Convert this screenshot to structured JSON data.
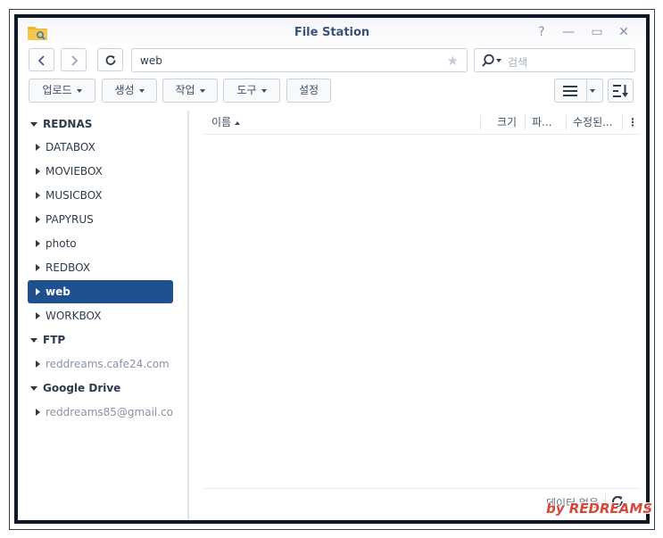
{
  "window": {
    "title": "File Station",
    "help_label": "?",
    "minimize_label": "—",
    "maximize_label": "▭",
    "close_label": "✕"
  },
  "navigation": {
    "back_icon": "chevron-left-icon",
    "forward_icon": "chevron-right-icon",
    "refresh_icon": "refresh-icon",
    "path_value": "web",
    "favorite_icon": "star-icon",
    "search_placeholder": "검색"
  },
  "toolbar": {
    "upload_label": "업로드",
    "create_label": "생성",
    "action_label": "작업",
    "tools_label": "도구",
    "settings_label": "설정"
  },
  "sidebar": {
    "groups": [
      {
        "label": "REDNAS",
        "items": [
          {
            "label": "DATABOX"
          },
          {
            "label": "MOVIEBOX"
          },
          {
            "label": "MUSICBOX"
          },
          {
            "label": "PAPYRUS"
          },
          {
            "label": "photo"
          },
          {
            "label": "REDBOX"
          },
          {
            "label": "web",
            "selected": true
          },
          {
            "label": "WORKBOX"
          }
        ]
      },
      {
        "label": "FTP",
        "items": [
          {
            "label": "reddreams.cafe24.com"
          }
        ]
      },
      {
        "label": "Google Drive",
        "items": [
          {
            "label": "reddreams85@gmail.com"
          }
        ]
      }
    ]
  },
  "file_list": {
    "columns": [
      {
        "label": "이름",
        "sort": "ascending"
      },
      {
        "label": "크기"
      },
      {
        "label": "파..."
      },
      {
        "label": "수정된..."
      }
    ],
    "rows": [],
    "empty_text": "데이터 없음"
  },
  "watermark": "by REDREAMS",
  "colors": {
    "accent": "#1f5090",
    "window_border": "#101826",
    "title_text": "#3a5275"
  }
}
